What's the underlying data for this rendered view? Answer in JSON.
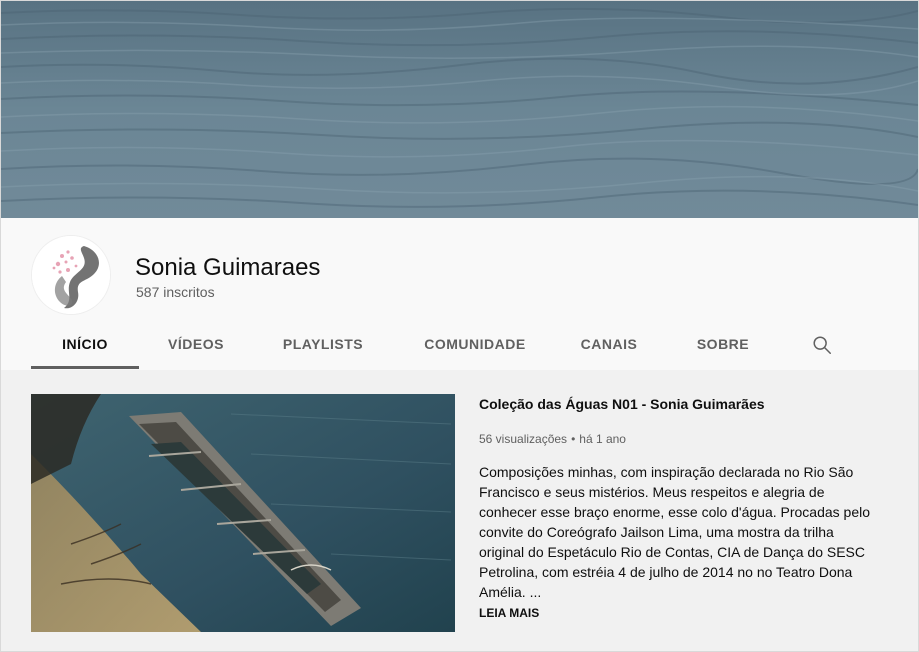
{
  "channel": {
    "name": "Sonia Guimaraes",
    "subscribers": "587 inscritos"
  },
  "tabs": [
    {
      "label": "INÍCIO",
      "active": true
    },
    {
      "label": "VÍDEOS",
      "active": false
    },
    {
      "label": "PLAYLISTS",
      "active": false
    },
    {
      "label": "COMUNIDADE",
      "active": false
    },
    {
      "label": "CANAIS",
      "active": false
    },
    {
      "label": "SOBRE",
      "active": false
    }
  ],
  "icons": {
    "search": "search-icon"
  },
  "featured_video": {
    "title": "Coleção das Águas N01 - Sonia Guimarães",
    "views": "56 visualizações",
    "separator": "•",
    "age": "há 1 ano",
    "description": "Composições minhas, com inspiração declarada no Rio São Francisco e seus mistérios. Meus respeitos e alegria de conhecer esse braço enorme, esse colo d'água. Procadas pelo convite do Coreógrafo Jailson Lima, uma mostra da trilha original do Espetáculo Rio de Contas, CIA de Dança do SESC Petrolina, com estréia 4 de julho de 2014 no no Teatro Dona Amélia. ...",
    "read_more": "LEIA MAIS"
  },
  "colors": {
    "tab_underline": "#606060",
    "secondary_text": "#606060",
    "content_bg": "#f1f1f1"
  }
}
